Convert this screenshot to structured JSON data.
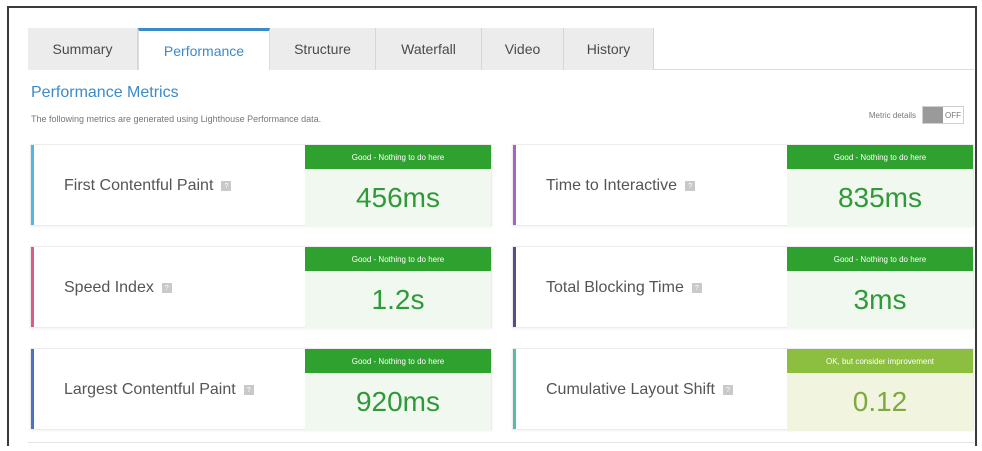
{
  "tabs": [
    {
      "label": "Summary",
      "active": false
    },
    {
      "label": "Performance",
      "active": true
    },
    {
      "label": "Structure",
      "active": false
    },
    {
      "label": "Waterfall",
      "active": false
    },
    {
      "label": "Video",
      "active": false
    },
    {
      "label": "History",
      "active": false
    }
  ],
  "section": {
    "title": "Performance Metrics",
    "description": "The following metrics are generated using Lighthouse Performance data.",
    "toggle_label": "Metric details",
    "toggle_state": "OFF"
  },
  "help_glyph": "?",
  "colors": {
    "good_badge": "#2ea12e",
    "good_value": "#2f9a38",
    "good_bg": "#f1f8ef",
    "ok_badge": "#8cbf3f",
    "ok_value": "#7fa93f",
    "ok_bg": "#f1f5df",
    "accent_blue": "#3b8ac9"
  },
  "metrics": [
    {
      "name": "First Contentful Paint",
      "badge": "Good - Nothing to do here",
      "value": "456ms",
      "accent": "#4fb7e5",
      "status": "good"
    },
    {
      "name": "Time to Interactive",
      "badge": "Good - Nothing to do here",
      "value": "835ms",
      "accent": "#a463c9",
      "status": "good"
    },
    {
      "name": "Speed Index",
      "badge": "Good - Nothing to do here",
      "value": "1.2s",
      "accent": "#e05a86",
      "status": "good"
    },
    {
      "name": "Total Blocking Time",
      "badge": "Good - Nothing to do here",
      "value": "3ms",
      "accent": "#5a4a8a",
      "status": "good"
    },
    {
      "name": "Largest Contentful Paint",
      "badge": "Good - Nothing to do here",
      "value": "920ms",
      "accent": "#4a73c8",
      "status": "good"
    },
    {
      "name": "Cumulative Layout Shift",
      "badge": "OK, but consider improvement",
      "value": "0.12",
      "accent": "#4fc1a6",
      "status": "ok"
    }
  ]
}
